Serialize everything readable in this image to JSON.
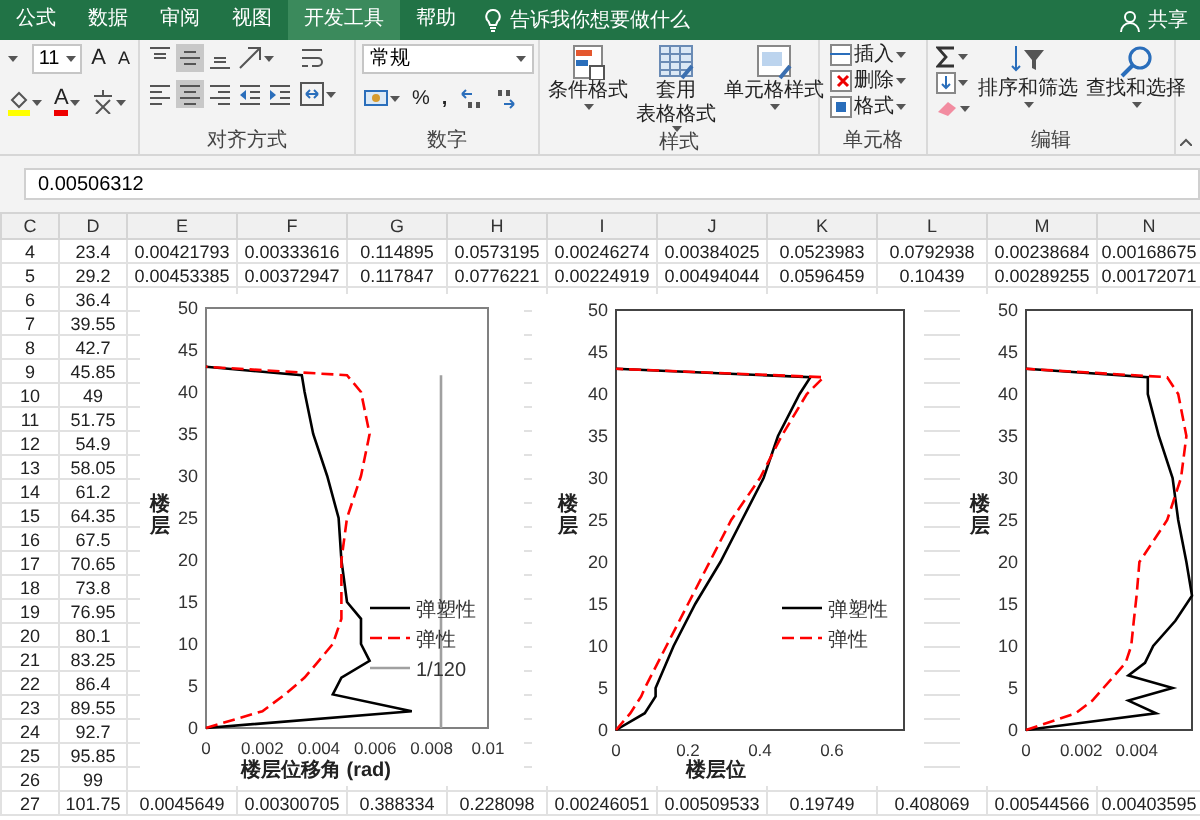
{
  "tabs": [
    {
      "label": "公式",
      "selected": false
    },
    {
      "label": "数据",
      "selected": false
    },
    {
      "label": "审阅",
      "selected": false
    },
    {
      "label": "视图",
      "selected": false
    },
    {
      "label": "开发工具",
      "selected": true
    },
    {
      "label": "帮助",
      "selected": false
    }
  ],
  "tell_me": "告诉我你想要做什么",
  "share": "共享",
  "ribbon": {
    "font": {
      "size": "11",
      "grow": "A",
      "shrink": "A",
      "font_color": "A"
    },
    "alignment": {
      "label": "对齐方式",
      "vertical": [
        {
          "kind": "top",
          "selected": false
        },
        {
          "kind": "middle",
          "selected": true
        },
        {
          "kind": "bottom",
          "selected": false
        }
      ],
      "horizontal": [
        {
          "kind": "left",
          "selected": false
        },
        {
          "kind": "center",
          "selected": true
        },
        {
          "kind": "right",
          "selected": false
        }
      ]
    },
    "number": {
      "format": "常规",
      "percent": "%",
      "comma": ",",
      "label": "数字"
    },
    "styles": {
      "buttons": [
        {
          "kind": "conditional",
          "label": "条件格式"
        },
        {
          "kind": "table",
          "lines": [
            "套用",
            "表格格式"
          ]
        },
        {
          "kind": "cellstyle",
          "label": "单元格样式"
        }
      ],
      "label": "样式"
    },
    "cells": {
      "buttons": [
        {
          "kind": "insert",
          "label": "插入"
        },
        {
          "kind": "delete",
          "label": "删除"
        },
        {
          "kind": "format",
          "label": "格式"
        }
      ],
      "label": "单元格"
    },
    "editing": {
      "buttons": [
        {
          "kind": "sort",
          "label": "排序和筛选"
        },
        {
          "kind": "find",
          "label": "查找和选择"
        }
      ],
      "label": "编辑"
    }
  },
  "formula_bar": {
    "value": "0.00506312"
  },
  "sheet": {
    "columns": [
      "C",
      "D",
      "E",
      "F",
      "G",
      "H",
      "I",
      "J",
      "K",
      "L",
      "M",
      "N"
    ],
    "rows": [
      {
        "cells": [
          "4",
          "23.4",
          "0.00421793",
          "0.00333616",
          "0.114895",
          "0.0573195",
          "0.00246274",
          "0.00384025",
          "0.0523983",
          "0.0792938",
          "0.00238684",
          "0.00168675"
        ]
      },
      {
        "cells": [
          "5",
          "29.2",
          "0.00453385",
          "0.00372947",
          "0.117847",
          "0.0776221",
          "0.00224919",
          "0.00494044",
          "0.0596459",
          "0.10439",
          "0.00289255",
          "0.00172071"
        ]
      },
      {
        "cells": [
          "6",
          "36.4"
        ]
      },
      {
        "cells": [
          "7",
          "39.55"
        ]
      },
      {
        "cells": [
          "8",
          "42.7"
        ]
      },
      {
        "cells": [
          "9",
          "45.85"
        ]
      },
      {
        "cells": [
          "10",
          "49"
        ]
      },
      {
        "cells": [
          "11",
          "51.75"
        ]
      },
      {
        "cells": [
          "12",
          "54.9"
        ]
      },
      {
        "cells": [
          "13",
          "58.05"
        ]
      },
      {
        "cells": [
          "14",
          "61.2"
        ]
      },
      {
        "cells": [
          "15",
          "64.35"
        ]
      },
      {
        "cells": [
          "16",
          "67.5"
        ]
      },
      {
        "cells": [
          "17",
          "70.65"
        ]
      },
      {
        "cells": [
          "18",
          "73.8"
        ]
      },
      {
        "cells": [
          "19",
          "76.95"
        ]
      },
      {
        "cells": [
          "20",
          "80.1"
        ]
      },
      {
        "cells": [
          "21",
          "83.25"
        ]
      },
      {
        "cells": [
          "22",
          "86.4"
        ]
      },
      {
        "cells": [
          "23",
          "89.55"
        ]
      },
      {
        "cells": [
          "24",
          "92.7"
        ]
      },
      {
        "cells": [
          "25",
          "95.85"
        ]
      },
      {
        "cells": [
          "26",
          "99"
        ]
      },
      {
        "cells": [
          "27",
          "101.75",
          "0.0045649",
          "0.00300705",
          "0.388334",
          "0.228098",
          "0.00246051",
          "0.00509533",
          "0.19749",
          "0.408069",
          "0.00544566",
          "0.00403595"
        ]
      }
    ]
  },
  "charts": [
    {
      "chart_data": {
        "type": "line",
        "orientation": "horizontal",
        "xlabel": "楼层位移角 (rad)",
        "ylabel": "楼层",
        "x": [
          0,
          2,
          4,
          6,
          8,
          10,
          13,
          15,
          20,
          25,
          30,
          35,
          40,
          42,
          43
        ],
        "xlim": [
          0,
          0.01
        ],
        "ylim": [
          0,
          50
        ],
        "xticks": [
          0,
          0.002,
          0.004,
          0.006,
          0.008,
          0.01
        ],
        "yticks": [
          0,
          5,
          10,
          15,
          20,
          25,
          30,
          35,
          40,
          45,
          50
        ],
        "legend": "right",
        "series": [
          {
            "name": "弹塑性",
            "color": "#000000",
            "line_style": "solid",
            "values": [
              0,
              0.0073,
              0.0045,
              0.0048,
              0.0058,
              0.0055,
              0.0055,
              0.005,
              0.0048,
              0.0047,
              0.0043,
              0.0038,
              0.0035,
              0.0034,
              0
            ]
          },
          {
            "name": "弹性",
            "color": "#ff0000",
            "line_style": "dashed",
            "values": [
              0,
              0.002,
              0.0028,
              0.0035,
              0.004,
              0.0045,
              0.0048,
              0.0048,
              0.0048,
              0.005,
              0.0055,
              0.0058,
              0.0055,
              0.005,
              0
            ]
          },
          {
            "name": "1/120",
            "color": "#a0a0a0",
            "line_style": "solid",
            "values": [
              0.00833,
              0.00833,
              0.00833,
              0.00833,
              0.00833,
              0.00833,
              0.00833,
              0.00833,
              0.00833,
              0.00833,
              0.00833,
              0.00833,
              0.00833,
              0.00833,
              null
            ]
          }
        ]
      }
    },
    {
      "chart_data": {
        "type": "line",
        "orientation": "horizontal",
        "xlabel": "楼层位",
        "ylabel": "楼层",
        "x": [
          0,
          2,
          4,
          5,
          10,
          15,
          20,
          25,
          30,
          35,
          40,
          42,
          43
        ],
        "xlim": [
          0,
          0.8
        ],
        "ylim": [
          0,
          50
        ],
        "xticks": [
          0,
          0.2,
          0.4,
          0.6
        ],
        "yticks": [
          0,
          5,
          10,
          15,
          20,
          25,
          30,
          35,
          40,
          45,
          50
        ],
        "legend": "right",
        "series": [
          {
            "name": "弹塑性",
            "color": "#000000",
            "line_style": "solid",
            "values": [
              0,
              0.08,
              0.11,
              0.11,
              0.16,
              0.22,
              0.29,
              0.35,
              0.41,
              0.45,
              0.51,
              0.54,
              0
            ]
          },
          {
            "name": "弹性",
            "color": "#ff0000",
            "line_style": "dashed",
            "values": [
              0,
              0.04,
              0.07,
              0.08,
              0.14,
              0.2,
              0.26,
              0.32,
              0.4,
              0.46,
              0.53,
              0.577,
              0
            ]
          }
        ]
      }
    },
    {
      "chart_data": {
        "type": "line",
        "orientation": "horizontal",
        "ylabel": "楼层",
        "x": [
          0,
          2,
          3.5,
          5,
          6.5,
          8,
          10,
          13,
          16,
          20,
          25,
          30,
          35,
          40,
          42,
          43
        ],
        "xlim": [
          0,
          0.006
        ],
        "ylim": [
          0,
          50
        ],
        "xticks": [
          0,
          0.002,
          0.004
        ],
        "yticks": [
          0,
          5,
          10,
          15,
          20,
          25,
          30,
          35,
          40,
          45,
          50
        ],
        "series": [
          {
            "color": "#000000",
            "line_style": "solid",
            "values": [
              0,
              0.0047,
              0.0037,
              0.0053,
              0.0037,
              0.0043,
              0.0046,
              0.0054,
              0.006,
              0.0058,
              0.0055,
              0.0053,
              0.0048,
              0.0044,
              0.0044,
              0
            ]
          },
          {
            "color": "#ff0000",
            "line_style": "dashed",
            "values": [
              0,
              0.0018,
              0.0024,
              0.0028,
              0.0032,
              0.0036,
              0.0038,
              0.0039,
              0.004,
              0.0041,
              0.0051,
              0.0056,
              0.0058,
              0.0055,
              0.0051,
              0
            ]
          }
        ]
      }
    }
  ]
}
